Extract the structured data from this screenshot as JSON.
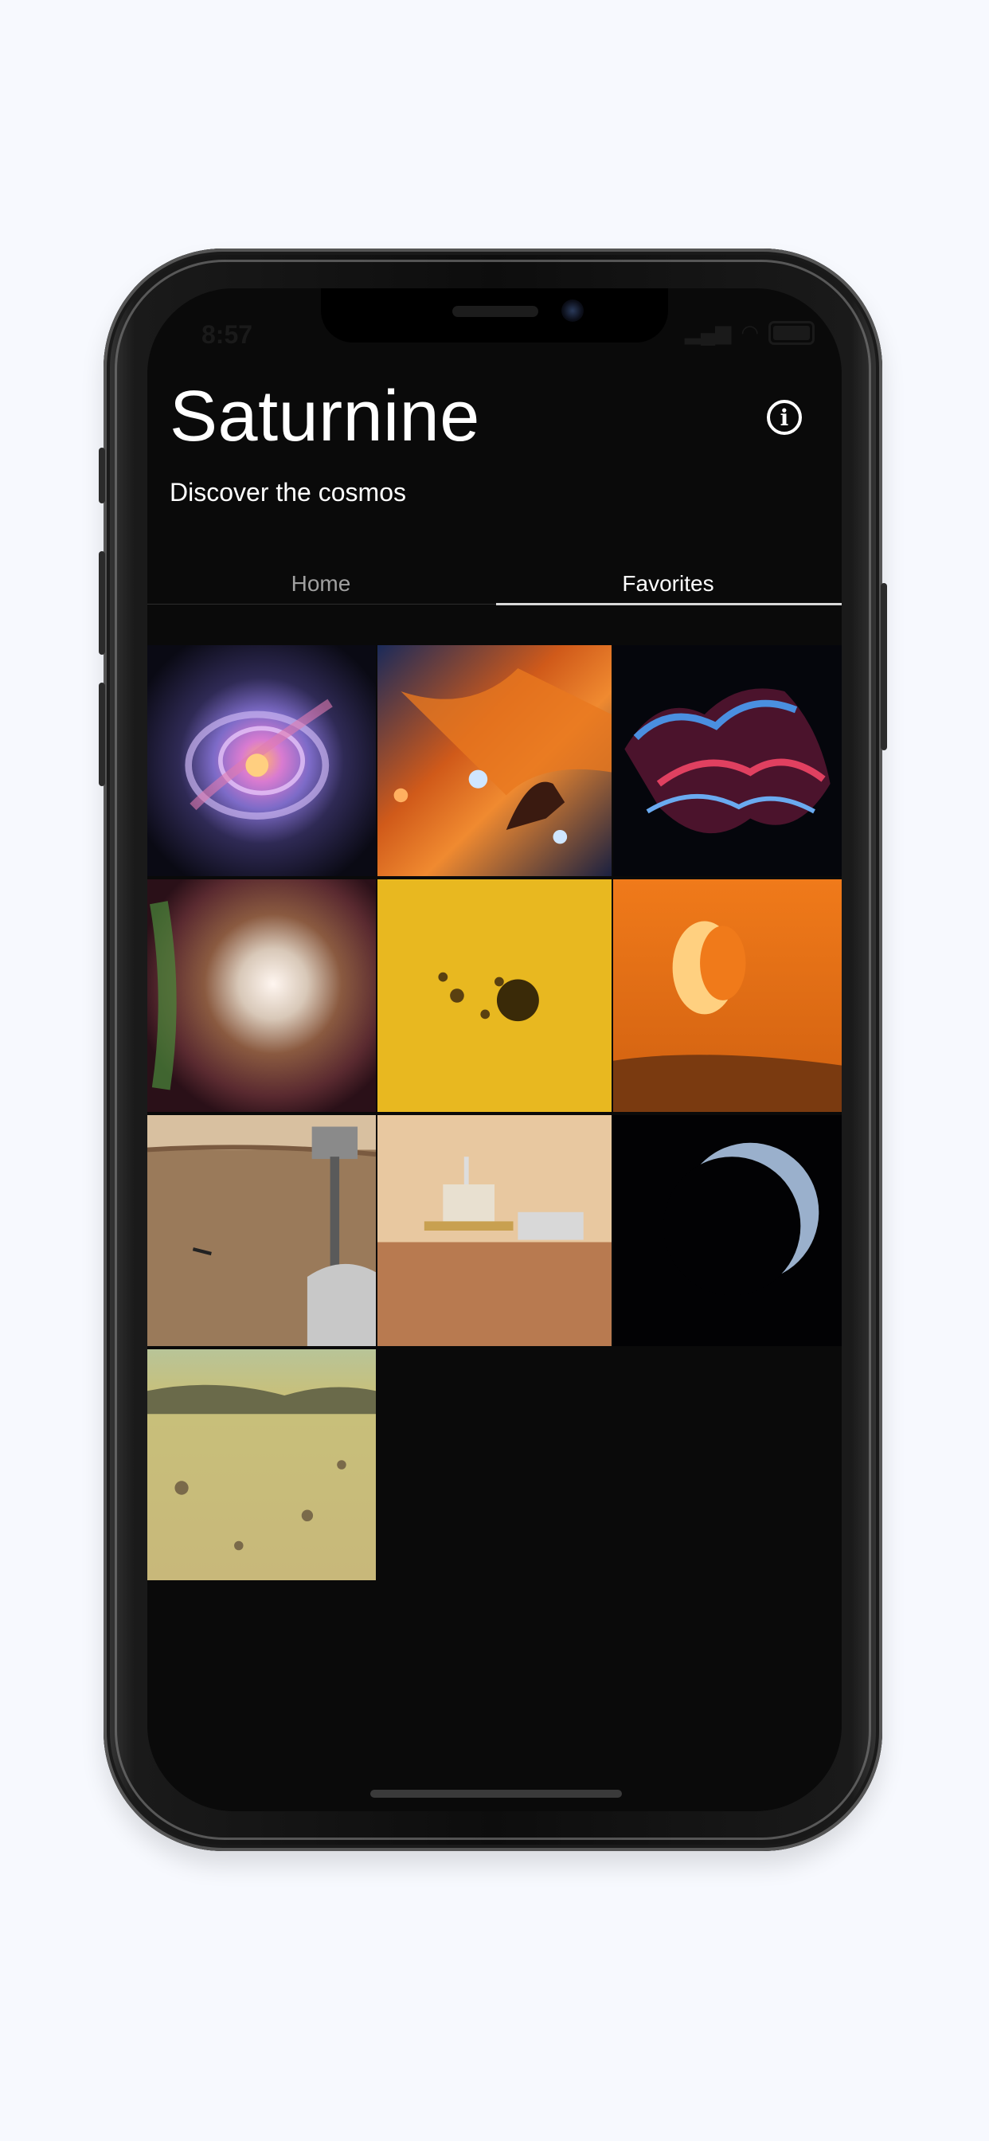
{
  "status_bar": {
    "time": "8:57"
  },
  "app": {
    "title": "Saturnine",
    "subtitle": "Discover the cosmos"
  },
  "tabs": [
    {
      "label": "Home",
      "selected": false
    },
    {
      "label": "Favorites",
      "selected": true
    }
  ],
  "favorites": [
    {
      "name": "cats-eye-nebula"
    },
    {
      "name": "horsehead-flame-nebula"
    },
    {
      "name": "veil-nebula"
    },
    {
      "name": "emission-nebula"
    },
    {
      "name": "sunspot-closeup"
    },
    {
      "name": "crescent-moonrise-orange"
    },
    {
      "name": "ingenuity-helicopter-rover"
    },
    {
      "name": "zhurong-rover-lander"
    },
    {
      "name": "crescent-earth"
    },
    {
      "name": "mars-surface"
    }
  ],
  "colors": {
    "background": "#0a0a0a",
    "accent": "#ffffff",
    "tab_inactive": "#a0a0a0"
  }
}
